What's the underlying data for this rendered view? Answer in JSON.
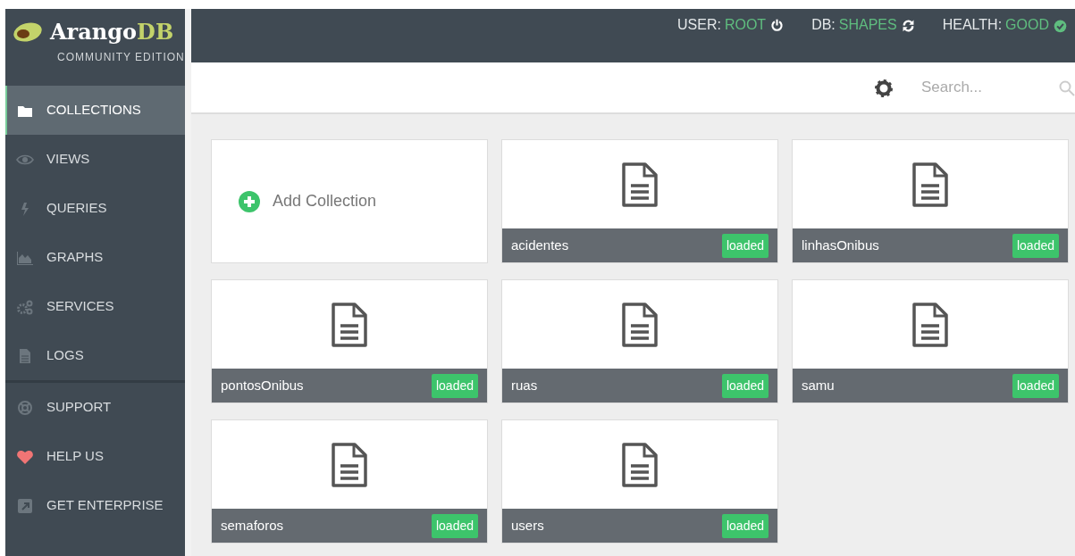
{
  "brand": {
    "name": "Arango",
    "name_accent": "DB",
    "edition": "COMMUNITY EDITION"
  },
  "status": [
    {
      "label": "USER:",
      "value": "ROOT"
    },
    {
      "label": "DB:",
      "value": "SHAPES"
    },
    {
      "label": "HEALTH:",
      "value": "GOOD"
    }
  ],
  "sidebar": {
    "sections": [
      {
        "items": [
          {
            "label": "COLLECTIONS",
            "selected": true
          },
          {
            "label": "VIEWS",
            "selected": false
          },
          {
            "label": "QUERIES",
            "selected": false
          },
          {
            "label": "GRAPHS",
            "selected": false
          },
          {
            "label": "SERVICES",
            "selected": false
          },
          {
            "label": "LOGS",
            "selected": false
          }
        ]
      },
      {
        "items": [
          {
            "label": "SUPPORT",
            "selected": false
          },
          {
            "label": "HELP US",
            "selected": false
          },
          {
            "label": "GET ENTERPRISE",
            "selected": false
          }
        ]
      }
    ]
  },
  "search": {
    "placeholder": "Search..."
  },
  "add_collection": {
    "label": "Add Collection"
  },
  "collections": [
    {
      "name": "acidentes",
      "status": "loaded"
    },
    {
      "name": "linhasOnibus",
      "status": "loaded"
    },
    {
      "name": "pontosOnibus",
      "status": "loaded"
    },
    {
      "name": "ruas",
      "status": "loaded"
    },
    {
      "name": "samu",
      "status": "loaded"
    },
    {
      "name": "semaforos",
      "status": "loaded"
    },
    {
      "name": "users",
      "status": "loaded"
    }
  ]
}
